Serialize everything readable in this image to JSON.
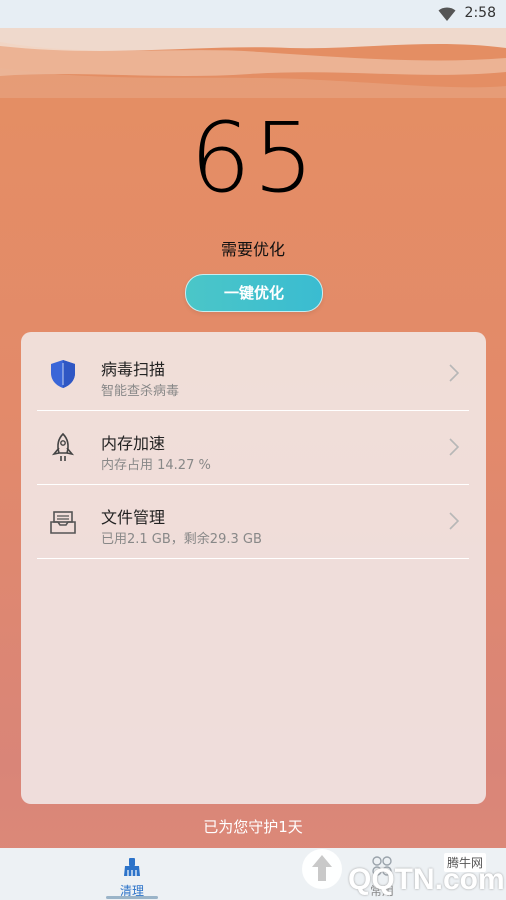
{
  "status_bar": {
    "time": "2:58"
  },
  "score": {
    "value": "65",
    "status": "需要优化"
  },
  "optimize_button": {
    "label": "一键优化"
  },
  "features": [
    {
      "title": "病毒扫描",
      "subtitle": "智能查杀病毒",
      "icon": "shield-icon"
    },
    {
      "title": "内存加速",
      "subtitle": "内存占用 14.27 %",
      "icon": "rocket-icon"
    },
    {
      "title": "文件管理",
      "subtitle": "已用2.1 GB，剩余29.3 GB",
      "icon": "inbox-icon"
    }
  ],
  "protection": {
    "text": "已为您守护1天"
  },
  "tabbar": {
    "tabs": [
      {
        "label": "清理",
        "icon": "broom-icon",
        "active": true
      },
      {
        "label": "常用",
        "icon": "apps-icon",
        "active": false
      }
    ]
  },
  "watermark": {
    "logo_text": "QQTN.com",
    "tag": "腾牛网"
  },
  "colors": {
    "accent": "#3abcd1",
    "tab_active": "#2c73c9",
    "shield": "#3a66d8"
  }
}
